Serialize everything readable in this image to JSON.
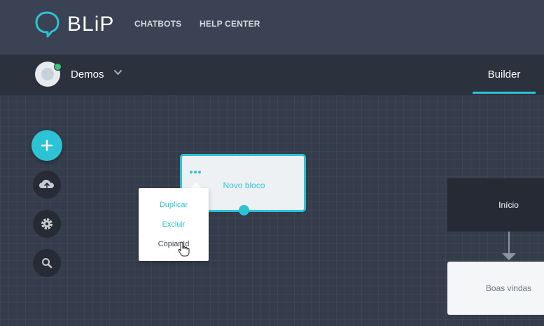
{
  "app": {
    "logo_text": "BLiP"
  },
  "nav": {
    "items": [
      {
        "label": "CHATBOTS"
      },
      {
        "label": "HELP CENTER"
      }
    ]
  },
  "bot": {
    "name": "Demos"
  },
  "tabs": {
    "active": "Builder"
  },
  "sidebar": {
    "tools": [
      "add-icon",
      "cloud-upload-icon",
      "gear-icon",
      "search-icon"
    ]
  },
  "canvas": {
    "block": {
      "title": "Novo bloco"
    },
    "context_menu": {
      "items": [
        "Duplicar",
        "Excluir",
        "Copiar Id"
      ]
    },
    "nodes": [
      {
        "label": "Início"
      },
      {
        "label": "Boas vindas"
      }
    ]
  },
  "colors": {
    "accent": "#2cc3d5",
    "online": "#3cc47c",
    "topbar": "#3a4253",
    "canvas": "#353c4b"
  }
}
